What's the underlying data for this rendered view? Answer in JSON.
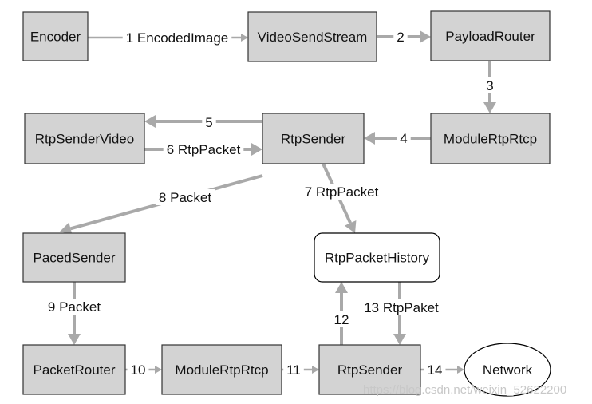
{
  "colors": {
    "node_fill": "#d3d3d3",
    "node_stroke": "#333333",
    "edge": "#a9a9a9",
    "history_fill": "#ffffff"
  },
  "nodes": [
    {
      "id": "encoder",
      "label": "Encoder",
      "shape": "rect"
    },
    {
      "id": "video-send-stream",
      "label": "VideoSendStream",
      "shape": "rect"
    },
    {
      "id": "payload-router",
      "label": "PayloadRouter",
      "shape": "rect"
    },
    {
      "id": "module-rtp-rtcp-top",
      "label": "ModuleRtpRtcp",
      "shape": "rect"
    },
    {
      "id": "rtp-sender-top",
      "label": "RtpSender",
      "shape": "rect"
    },
    {
      "id": "rtp-sender-video",
      "label": "RtpSenderVideo",
      "shape": "rect"
    },
    {
      "id": "paced-sender",
      "label": "PacedSender",
      "shape": "rect"
    },
    {
      "id": "rtp-packet-history",
      "label": "RtpPacketHistory",
      "shape": "rounded"
    },
    {
      "id": "packet-router",
      "label": "PacketRouter",
      "shape": "rect"
    },
    {
      "id": "module-rtp-rtcp-bottom",
      "label": "ModuleRtpRtcp",
      "shape": "rect"
    },
    {
      "id": "rtp-sender-bottom",
      "label": "RtpSender",
      "shape": "rect"
    },
    {
      "id": "network",
      "label": "Network",
      "shape": "ellipse"
    }
  ],
  "edges": [
    {
      "from": "encoder",
      "to": "video-send-stream",
      "label": "1 EncodedImage"
    },
    {
      "from": "video-send-stream",
      "to": "payload-router",
      "label": "2"
    },
    {
      "from": "payload-router",
      "to": "module-rtp-rtcp-top",
      "label": "3"
    },
    {
      "from": "module-rtp-rtcp-top",
      "to": "rtp-sender-top",
      "label": "4"
    },
    {
      "from": "rtp-sender-top",
      "to": "rtp-sender-video",
      "label": "5"
    },
    {
      "from": "rtp-sender-video",
      "to": "rtp-sender-top",
      "label": "6 RtpPacket"
    },
    {
      "from": "rtp-sender-top",
      "to": "rtp-packet-history",
      "label": "7 RtpPacket"
    },
    {
      "from": "rtp-sender-top",
      "to": "paced-sender",
      "label": "8 Packet"
    },
    {
      "from": "paced-sender",
      "to": "packet-router",
      "label": "9 Packet"
    },
    {
      "from": "packet-router",
      "to": "module-rtp-rtcp-bottom",
      "label": "10"
    },
    {
      "from": "module-rtp-rtcp-bottom",
      "to": "rtp-sender-bottom",
      "label": "11"
    },
    {
      "from": "rtp-sender-bottom",
      "to": "rtp-packet-history",
      "label": "12"
    },
    {
      "from": "rtp-packet-history",
      "to": "rtp-sender-bottom",
      "label": "13 RtpPaket"
    },
    {
      "from": "rtp-sender-bottom",
      "to": "network",
      "label": "14"
    }
  ],
  "watermark": "https://blog.csdn.net/weixin_52622200"
}
